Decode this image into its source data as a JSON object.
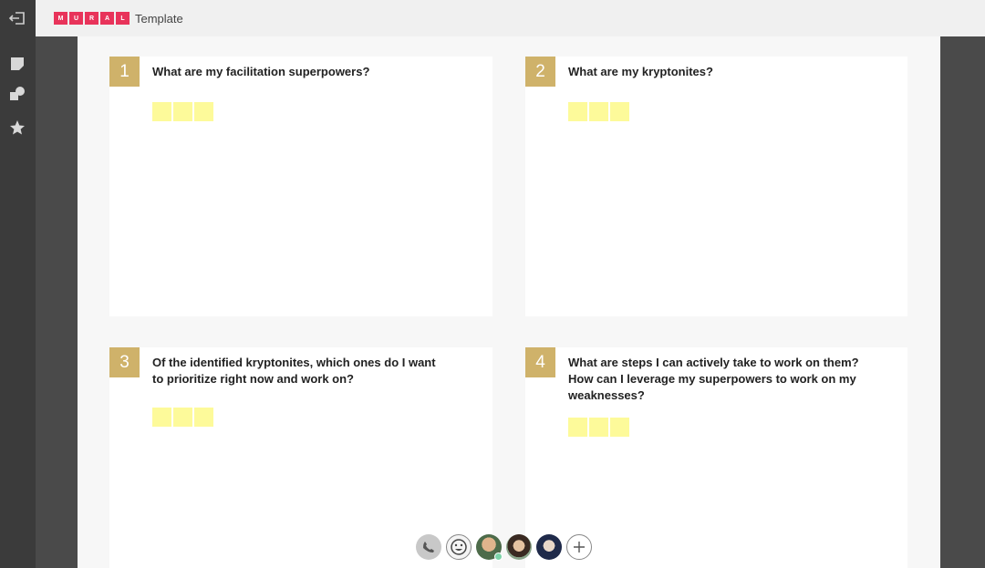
{
  "header": {
    "logo_letters": [
      "M",
      "U",
      "R",
      "A",
      "L"
    ],
    "title": "Template"
  },
  "sidebar": {
    "icons": [
      "exit-icon",
      "sticky-note-icon",
      "shapes-icon",
      "star-icon"
    ]
  },
  "panels": [
    {
      "number": "1",
      "question": "What are my facilitation superpowers?"
    },
    {
      "number": "2",
      "question": "What are my kryptonites?"
    },
    {
      "number": "3",
      "question_lines": [
        "Of the identified kryptonites, which ones do I want",
        "to prioritize right now and work on?"
      ]
    },
    {
      "number": "4",
      "question_lines": [
        "What are steps I can actively take to work on them?",
        "How can I leverage my superpowers to work on my",
        "weaknesses?"
      ]
    }
  ],
  "bottom_bar": {
    "items": [
      "phone-icon",
      "emoji-icon",
      "avatar",
      "avatar",
      "avatar",
      "plus-icon"
    ]
  },
  "colors": {
    "accent": "#cfb26a",
    "logo": "#e8335a",
    "sticky": "#fdfa9a"
  }
}
